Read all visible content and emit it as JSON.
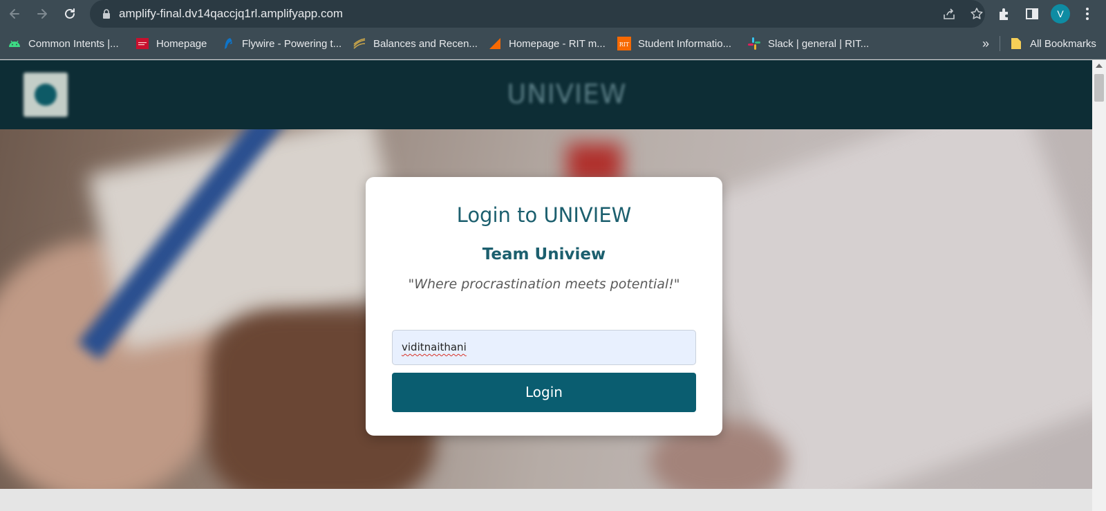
{
  "browser": {
    "url": "amplify-final.dv14qaccjq1rl.amplifyapp.com",
    "profile_initial": "V",
    "bookmarks": [
      {
        "label": "Common Intents  |...",
        "icon": "android-icon"
      },
      {
        "label": "Homepage",
        "icon": "oracle-icon"
      },
      {
        "label": "Flywire - Powering t...",
        "icon": "flywire-icon"
      },
      {
        "label": "Balances and Recen...",
        "icon": "balances-icon"
      },
      {
        "label": "Homepage - RIT m...",
        "icon": "rit-triangle-icon"
      },
      {
        "label": "Student Informatio...",
        "icon": "rit-icon"
      },
      {
        "label": "Slack | general | RIT...",
        "icon": "slack-icon"
      }
    ],
    "overflow_label": "»",
    "all_bookmarks_label": "All Bookmarks",
    "colors": {
      "chrome": "#3c4b54",
      "omnibox": "#2b3a43",
      "avatar": "#0e8ca3"
    }
  },
  "app": {
    "brand": "UNIVIEW",
    "colors": {
      "header": "#0d2d35",
      "primary": "#0a5d70",
      "title": "#1c5f6e"
    }
  },
  "login": {
    "title": "Login to UNIVIEW",
    "team": "Team Uniview",
    "tagline": "\"Where procrastination meets potential!\"",
    "username_value": "viditnaithani",
    "button_label": "Login"
  }
}
